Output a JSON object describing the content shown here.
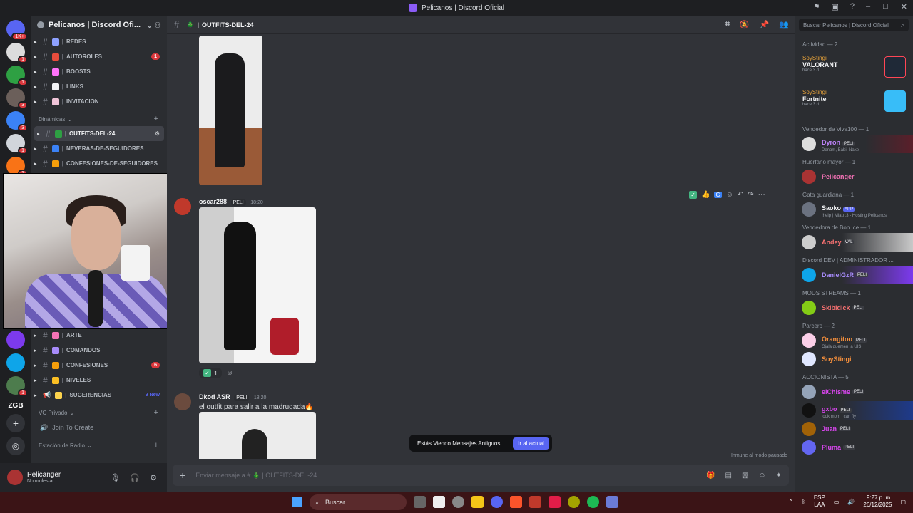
{
  "window": {
    "title": "Pelicanos | Discord Oficial"
  },
  "guilds": {
    "mention_badge": "1K+",
    "badges": [
      "1",
      "1",
      "3",
      "3",
      "1",
      "1",
      "1"
    ],
    "text_guild": "ZGB"
  },
  "server": {
    "name": "Pelicanos | Discord Ofi..."
  },
  "channels_top": [
    {
      "name": "REDES",
      "badge": ""
    },
    {
      "name": "AUTOROLES",
      "badge": "1"
    },
    {
      "name": "BOOSTS",
      "badge": ""
    },
    {
      "name": "LINKS",
      "badge": ""
    },
    {
      "name": "INVITACION",
      "badge": ""
    }
  ],
  "category_dinamicas": "Dinámicas",
  "channels_din": [
    {
      "name": "OUTFITS-DEL-24",
      "active": true
    },
    {
      "name": "NEVERAS-DE-SEGUIDORES"
    },
    {
      "name": "CONFESIONES-DE-SEGUIDORES"
    }
  ],
  "channels_bottom": [
    {
      "name": "ARTE",
      "badge": ""
    },
    {
      "name": "COMANDOS",
      "badge": ""
    },
    {
      "name": "CONFESIONES",
      "badge": "6"
    },
    {
      "name": "NIVELES",
      "badge": ""
    },
    {
      "name": "SUGERENCIAS",
      "badge": "9 New"
    }
  ],
  "category_vc": "VC Privado",
  "voice_join": "Join To Create",
  "category_radio": "Estación de Radio",
  "user": {
    "name": "Pelicanger",
    "status": "No molestar"
  },
  "chat": {
    "channel": "OUTFITS-DEL-24",
    "messages": [
      {
        "author": "oscar288",
        "tag": "PELI",
        "time": "18:20",
        "reaction_count": "1"
      },
      {
        "author": "Dkod ASR",
        "tag": "PELI",
        "time": "18:20",
        "text": "el outfit para salir a la madrugada🔥"
      }
    ],
    "old_banner": "Estás Viendo Mensajes Antiguos",
    "old_button": "Ir al actual",
    "immune": "Inmune al modo pausado",
    "composer_placeholder": "Enviar mensaje a # 🎄 | OUTFITS-DEL-24"
  },
  "members": {
    "search_placeholder": "Buscar Pelicanos | Discord Oficial",
    "activity_title": "Actividad — 2",
    "activities": [
      {
        "user": "SoyStingi",
        "game": "VALORANT",
        "time": "hace 3 d"
      },
      {
        "user": "SoyStingi",
        "game": "Fortnite",
        "time": "hace 3 d"
      }
    ],
    "groups": [
      {
        "role": "Vendedor de Vive100 — 1",
        "members": [
          {
            "name": "Dyron",
            "tag": "PELI",
            "sub": "Denom, Babi, Nake"
          }
        ]
      },
      {
        "role": "Huérfano mayor — 1",
        "members": [
          {
            "name": "Pelicanger",
            "tag": "",
            "sub": ""
          }
        ]
      },
      {
        "role": "Gata guardiana — 1",
        "members": [
          {
            "name": "Saoko",
            "tag": "APP",
            "sub": "!help | Miau :3 - Hosting Pelicanos"
          }
        ]
      },
      {
        "role": "Vendedora de Bon Ice — 1",
        "members": [
          {
            "name": "Andey",
            "tag": "VAL",
            "sub": ""
          }
        ]
      },
      {
        "role": "Discord DEV | ADMINISTRADOR ...",
        "members": [
          {
            "name": "DanielGzR",
            "tag": "PELI",
            "sub": ""
          }
        ]
      },
      {
        "role": "MODS STREAMS — 1",
        "members": [
          {
            "name": "Skibidick",
            "tag": "PELI",
            "sub": ""
          }
        ]
      },
      {
        "role": "Parcero — 2",
        "members": [
          {
            "name": "Orangitoo",
            "tag": "PELI",
            "sub": "Ojala quemen la UIS"
          },
          {
            "name": "SoyStingi",
            "tag": "",
            "sub": ""
          }
        ]
      },
      {
        "role": "ACCIONISTA — 5",
        "members": [
          {
            "name": "elChisme",
            "tag": "PELI",
            "sub": ""
          },
          {
            "name": "gxbo",
            "tag": "PELI",
            "sub": "look mom i can fly"
          },
          {
            "name": "Juan",
            "tag": "PELI",
            "sub": ""
          },
          {
            "name": "Pluma",
            "tag": "PELI",
            "sub": ""
          }
        ]
      }
    ]
  },
  "taskbar": {
    "search": "Buscar",
    "lang1": "ESP",
    "lang2": "LAA",
    "time": "9:27 p. m.",
    "date": "26/12/2025"
  },
  "colors": {
    "accent": "#5865f2",
    "sidebar": "#2b2d31",
    "chat": "#313338",
    "taskbar": "#3b1416"
  }
}
